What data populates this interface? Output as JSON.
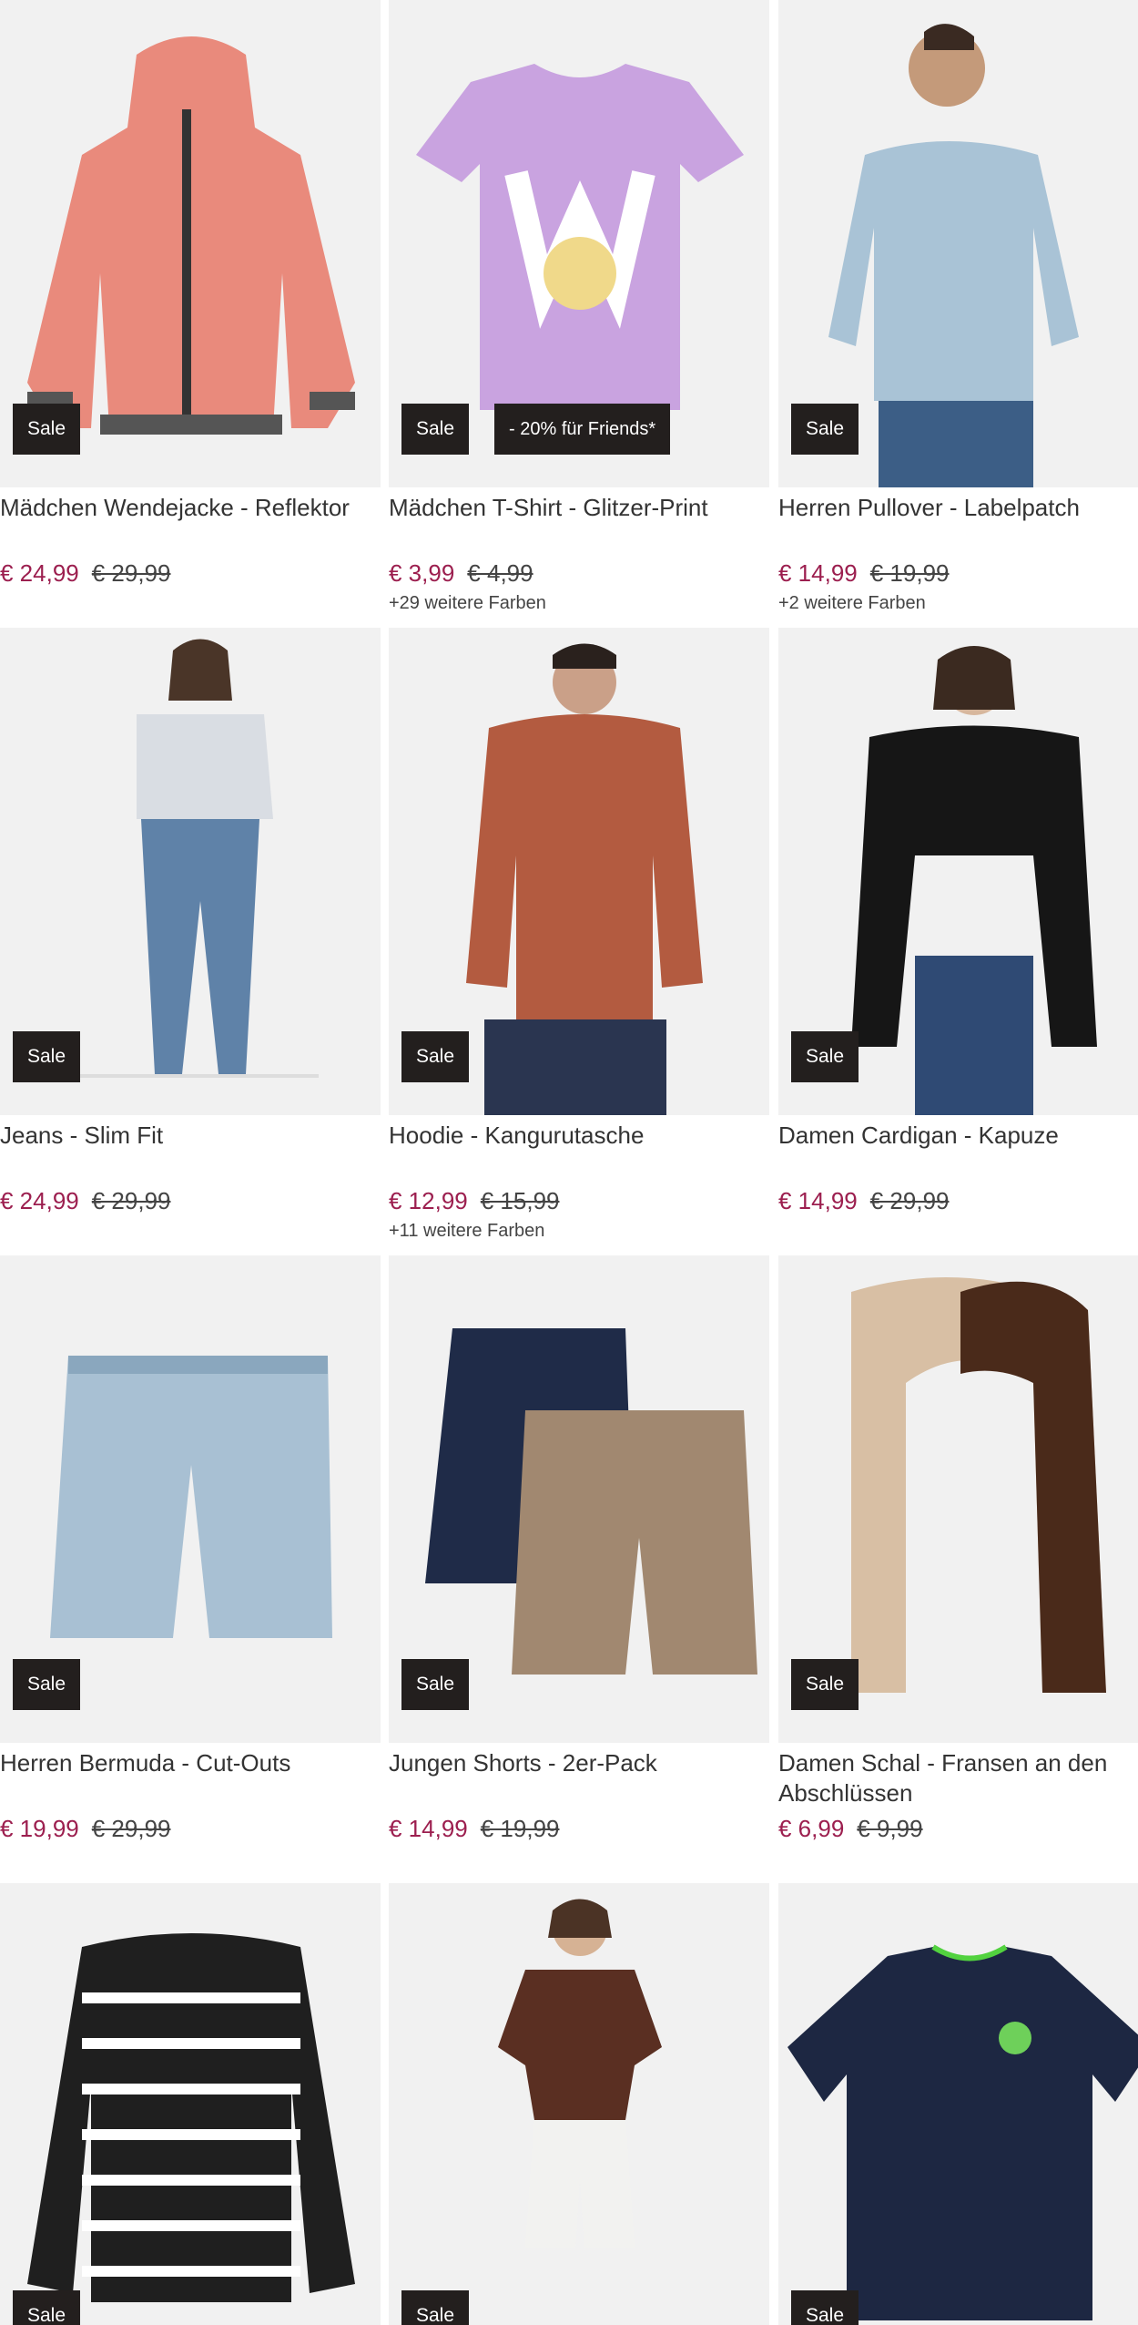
{
  "colors": {
    "accent": "#9c1f4f",
    "badge_bg": "#231f1e",
    "image_bg": "#f1f1f1"
  },
  "products": [
    {
      "name": "Mädchen Wendejacke - Reflektor",
      "price": "€ 24,99",
      "old_price": "€ 29,99",
      "badge": "Sale",
      "promo": "",
      "colors_note": "",
      "image": "pink-puffer-jacket"
    },
    {
      "name": "Mädchen T-Shirt - Glitzer-Print",
      "price": "€ 3,99",
      "old_price": "€ 4,99",
      "badge": "Sale",
      "promo": "- 20% für Friends*",
      "colors_note": "+29 weitere Farben",
      "image": "lilac-tshirt-w-print"
    },
    {
      "name": "Herren Pullover - Labelpatch",
      "price": "€ 14,99",
      "old_price": "€ 19,99",
      "badge": "Sale",
      "promo": "",
      "colors_note": "+2 weitere Farben",
      "image": "man-light-blue-sweater"
    },
    {
      "name": "Jeans - Slim Fit",
      "price": "€ 24,99",
      "old_price": "€ 29,99",
      "badge": "Sale",
      "promo": "",
      "colors_note": "",
      "image": "woman-jeans-floral-top"
    },
    {
      "name": "Hoodie - Kangurutasche",
      "price": "€ 12,99",
      "old_price": "€ 15,99",
      "badge": "Sale",
      "promo": "",
      "colors_note": "+11 weitere Farben",
      "image": "man-rust-hoodie"
    },
    {
      "name": "Damen Cardigan - Kapuze",
      "price": "€ 14,99",
      "old_price": "€ 29,99",
      "badge": "Sale",
      "promo": "",
      "colors_note": "",
      "image": "woman-black-cardigan"
    },
    {
      "name": "Herren Bermuda - Cut-Outs",
      "price": "€ 19,99",
      "old_price": "€ 29,99",
      "badge": "Sale",
      "promo": "",
      "colors_note": "",
      "image": "denim-bermuda-shorts"
    },
    {
      "name": "Jungen Shorts - 2er-Pack",
      "price": "€ 14,99",
      "old_price": "€ 19,99",
      "badge": "Sale",
      "promo": "",
      "colors_note": "",
      "image": "navy-beige-shorts"
    },
    {
      "name": "Damen Schal - Fransen an den Abschlüssen",
      "price": "€ 6,99",
      "old_price": "€ 9,99",
      "badge": "Sale",
      "promo": "",
      "colors_note": "",
      "image": "brown-beige-scarf"
    },
    {
      "name": "",
      "price": "",
      "old_price": "",
      "badge": "Sale",
      "promo": "",
      "colors_note": "",
      "image": "striped-longsleeve"
    },
    {
      "name": "",
      "price": "",
      "old_price": "",
      "badge": "Sale",
      "promo": "",
      "colors_note": "",
      "image": "woman-brown-top-white-shorts"
    },
    {
      "name": "",
      "price": "",
      "old_price": "",
      "badge": "Sale",
      "promo": "",
      "colors_note": "",
      "image": "navy-polo-shirt"
    }
  ]
}
